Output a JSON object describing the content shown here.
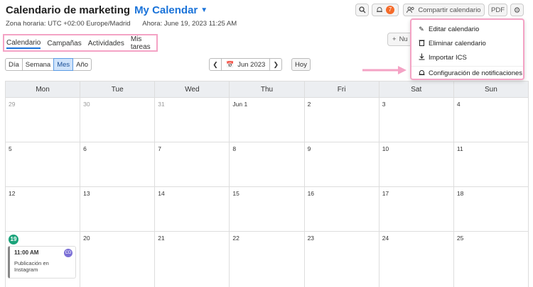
{
  "header": {
    "app_title": "Calendario de marketing",
    "calendar_name": "My Calendar",
    "timezone": "Zona horaria: UTC +02:00 Europe/Madrid",
    "now": "Ahora: June 19, 2023 11:25 AM"
  },
  "toolbar": {
    "notifications_count": "7",
    "share_label": "Compartir calendario",
    "pdf_label": "PDF",
    "new_label": "Nu"
  },
  "tabs": [
    "Calendario",
    "Campañas",
    "Actividades",
    "Mis tareas"
  ],
  "views": [
    "Día",
    "Semana",
    "Mes",
    "Año"
  ],
  "date_nav": {
    "current": "Jun 2023",
    "today_label": "Hoy"
  },
  "menu": [
    {
      "label": "Editar calendario"
    },
    {
      "label": "Eliminar calendario"
    },
    {
      "label": "Importar ICS"
    },
    {
      "label": "Configuración de notificaciones"
    }
  ],
  "weekdays": [
    "Mon",
    "Tue",
    "Wed",
    "Thu",
    "Fri",
    "Sat",
    "Sun"
  ],
  "weeks": [
    [
      "29",
      "30",
      "31",
      "Jun 1",
      "2",
      "3",
      "4"
    ],
    [
      "5",
      "6",
      "7",
      "8",
      "9",
      "10",
      "11"
    ],
    [
      "12",
      "13",
      "14",
      "15",
      "16",
      "17",
      "18"
    ],
    [
      "19",
      "20",
      "21",
      "22",
      "23",
      "24",
      "25"
    ]
  ],
  "event": {
    "time": "11:00 AM",
    "avatar": "CD",
    "title": "Publicación en Instagram"
  },
  "colors": {
    "accent": "#1a73d9",
    "highlight": "#f4a3c5",
    "today": "#1aa37a",
    "badge": "#f56b2a"
  }
}
